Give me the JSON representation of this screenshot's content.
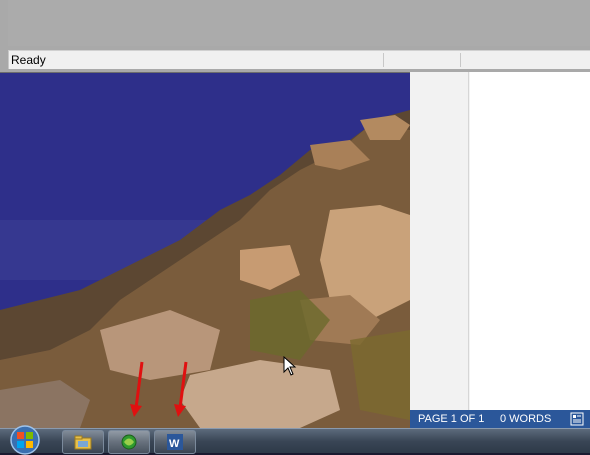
{
  "top_window": {
    "status_text": "Ready"
  },
  "word": {
    "page_info": "PAGE 1 OF 1",
    "word_count": "0 WORDS"
  },
  "taskbar": {
    "start_icon": "windows-logo-icon",
    "buttons": [
      {
        "name": "file-explorer-icon"
      },
      {
        "name": "green-app-icon"
      },
      {
        "name": "word-icon"
      }
    ]
  },
  "colors": {
    "word_status_bar": "#2b579a",
    "taskbar": "#3a4656",
    "annotation_arrow": "#e01010"
  }
}
